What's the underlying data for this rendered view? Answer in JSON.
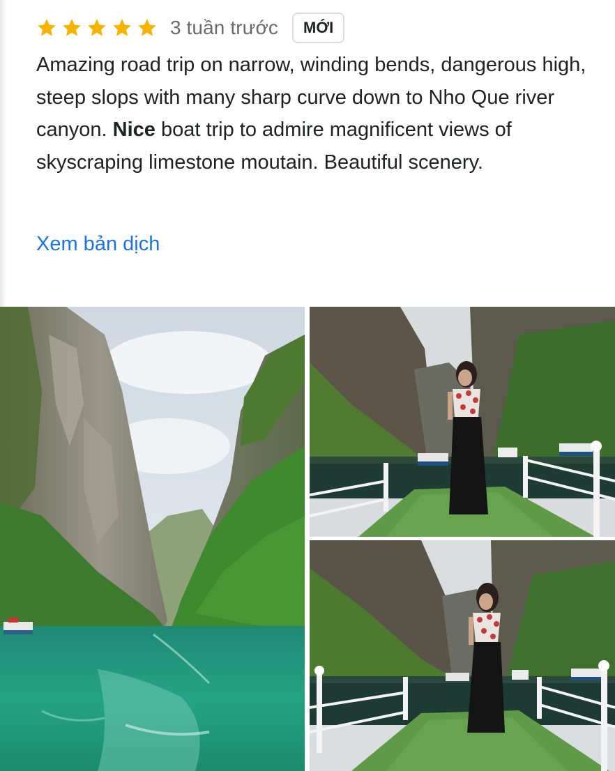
{
  "review": {
    "rating": 5,
    "rating_max": 5,
    "star_color": "#f5b400",
    "time_ago": "3 tuần trước",
    "badge": "MỚI",
    "text_part1": "Amazing road trip on narrow, winding bends, dangerous high, steep slops with many sharp curve down to Nho Que river canyon. ",
    "text_bold": "Nice",
    "text_part2": " boat trip to admire magnificent views of skyscraping limestone moutain. Beautiful scenery.",
    "translate_link": "Xem bản dịch",
    "link_color": "#1a73e8"
  },
  "photos": [
    {
      "name": "canyon-river-photo"
    },
    {
      "name": "woman-on-boat-photo-1"
    },
    {
      "name": "woman-on-boat-photo-2"
    }
  ]
}
